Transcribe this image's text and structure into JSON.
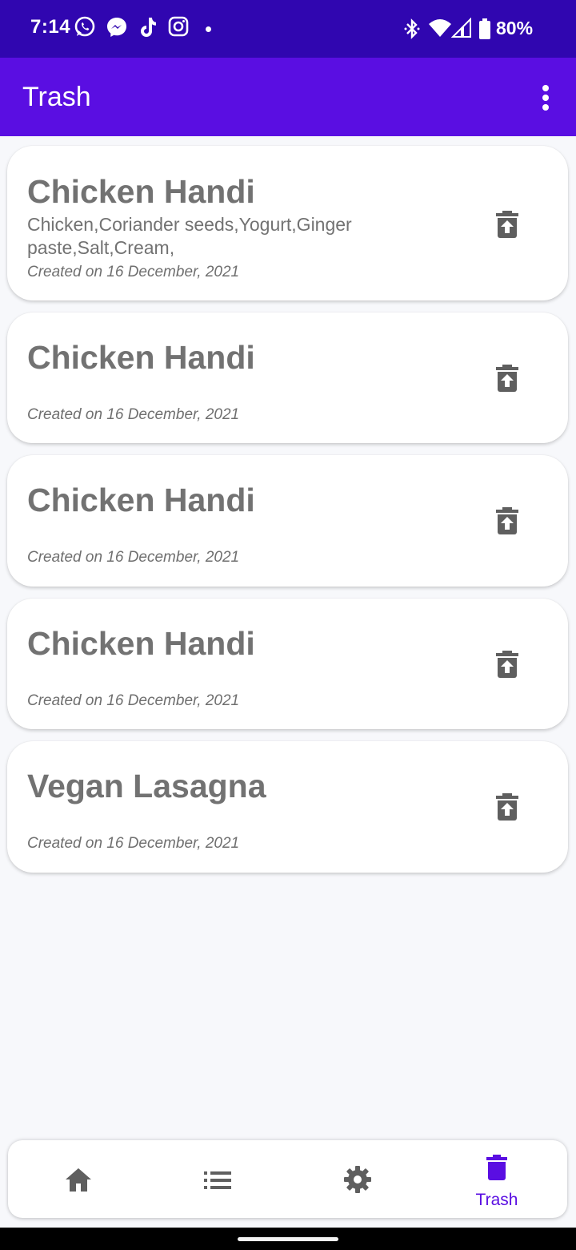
{
  "status_bar": {
    "time": "7:14",
    "battery": "80%",
    "icons_left": [
      "whatsapp-icon",
      "messenger-icon",
      "tiktok-icon",
      "instagram-icon",
      "notification-dot"
    ],
    "icons_right": [
      "bluetooth-icon",
      "wifi-icon",
      "cell-signal-icon",
      "battery-icon"
    ]
  },
  "app_bar": {
    "title": "Trash",
    "menu_icon": "more-vert-icon"
  },
  "recipes": [
    {
      "title": "Chicken Handi",
      "ingredients": "Chicken,Coriander seeds,Yogurt,Ginger paste,Salt,Cream,",
      "date": "Created on 16 December, 2021"
    },
    {
      "title": "Chicken Handi",
      "ingredients": "",
      "date": "Created on 16 December, 2021"
    },
    {
      "title": "Chicken Handi",
      "ingredients": "",
      "date": "Created on 16 December, 2021"
    },
    {
      "title": "Chicken Handi",
      "ingredients": "",
      "date": "Created on 16 December, 2021"
    },
    {
      "title": "Vegan Lasagna",
      "ingredients": "",
      "date": "Created on 16 December, 2021"
    }
  ],
  "card_action_icon": "restore-from-trash-icon",
  "bottom_nav": {
    "items": [
      {
        "icon": "home-icon",
        "label": "",
        "active": false
      },
      {
        "icon": "list-icon",
        "label": "",
        "active": false
      },
      {
        "icon": "settings-icon",
        "label": "",
        "active": false
      },
      {
        "icon": "trash-icon",
        "label": "Trash",
        "active": true
      }
    ]
  },
  "colors": {
    "status_bar": "#3006b0",
    "app_bar": "#5a0ee2",
    "accent": "#5a0ee2",
    "text_gray": "#727272",
    "icon_gray": "#5f5f5f",
    "background": "#f7f8fb"
  }
}
